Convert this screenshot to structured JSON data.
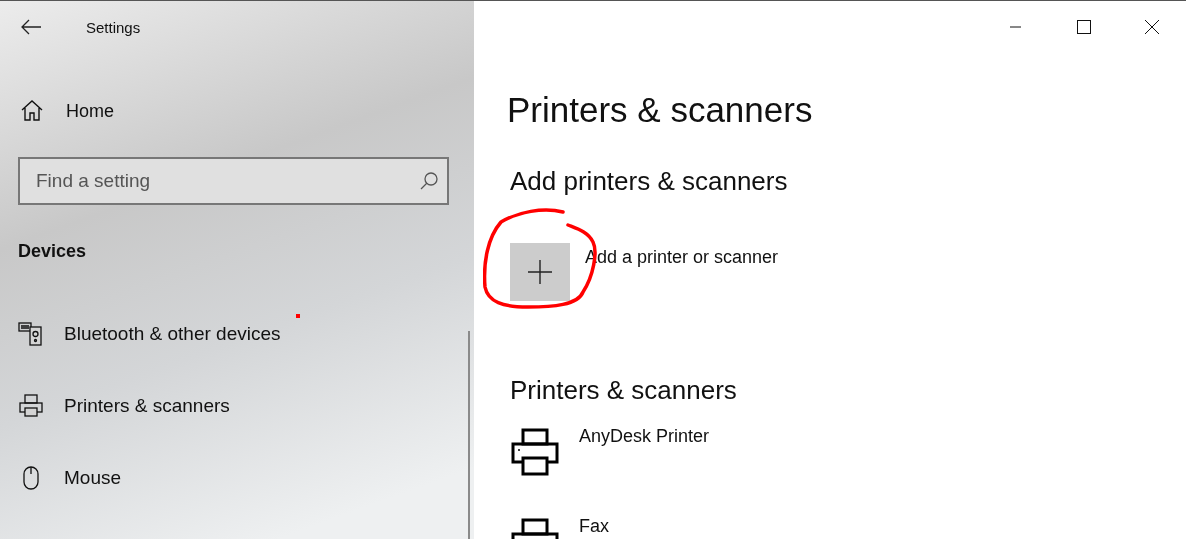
{
  "window": {
    "title": "Settings"
  },
  "sidebar": {
    "home": "Home",
    "search": {
      "placeholder": "Find a setting"
    },
    "section": "Devices",
    "items": [
      {
        "label": "Bluetooth & other devices",
        "kind": "bluetooth"
      },
      {
        "label": "Printers & scanners",
        "kind": "printer"
      },
      {
        "label": "Mouse",
        "kind": "mouse"
      }
    ]
  },
  "main": {
    "title": "Printers & scanners",
    "add_section": "Add printers & scanners",
    "add_label": "Add a printer or scanner",
    "list_heading": "Printers & scanners",
    "printers": [
      {
        "name": "AnyDesk Printer"
      },
      {
        "name": "Fax"
      }
    ]
  }
}
